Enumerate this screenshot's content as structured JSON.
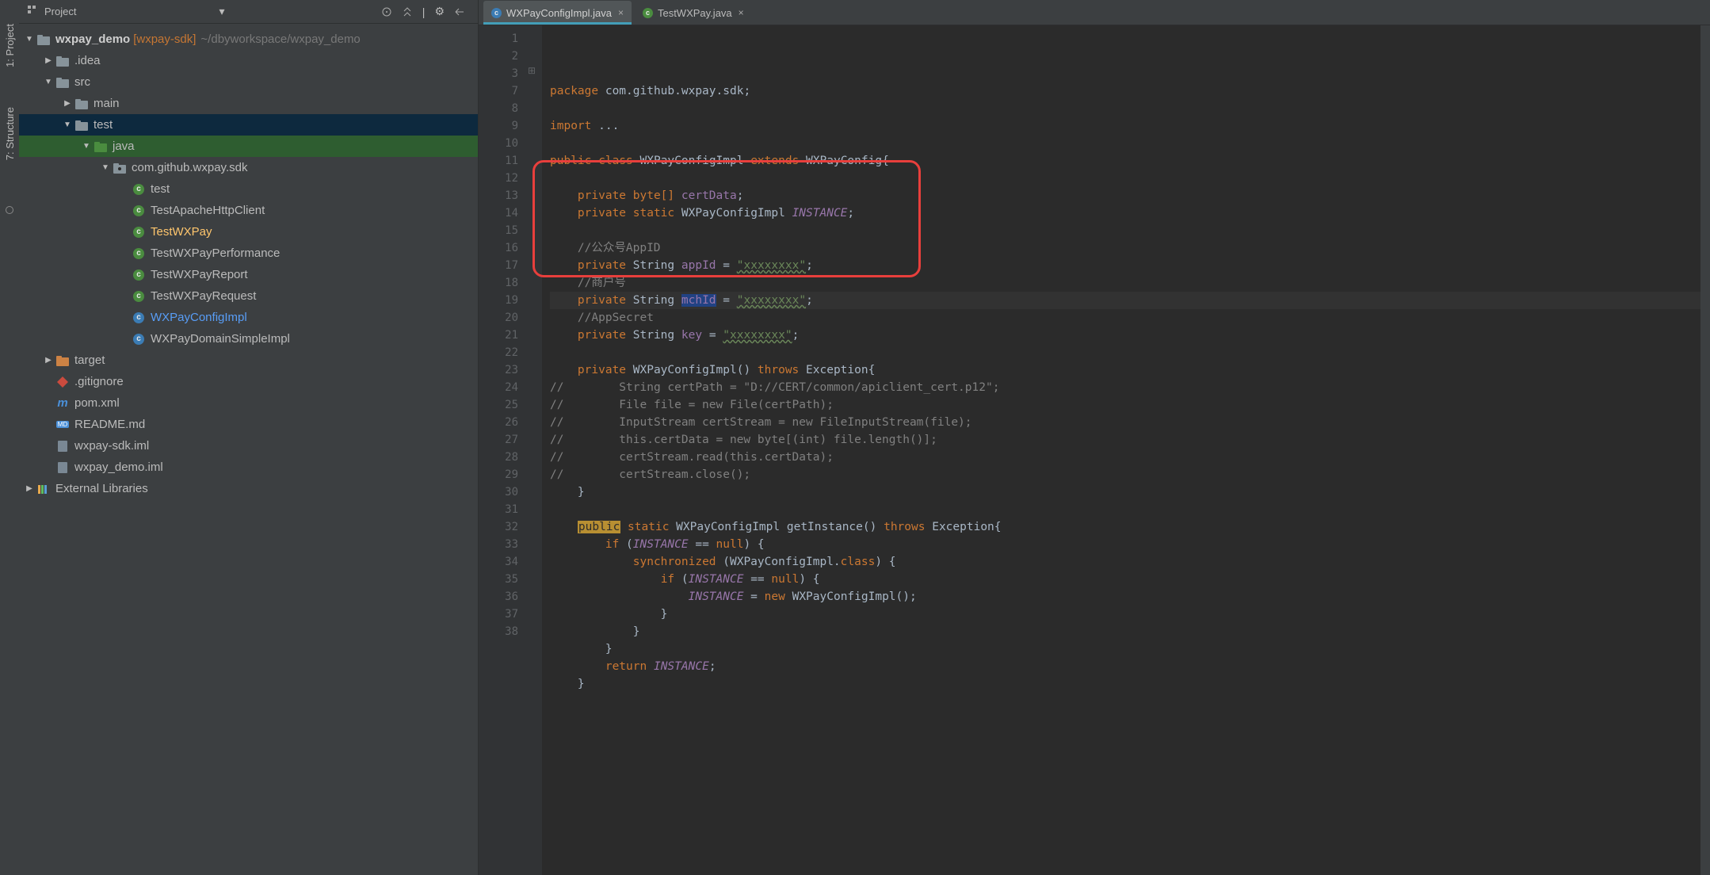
{
  "sideTools": {
    "project": "1: Project",
    "structure": "7: Structure"
  },
  "projectHeader": {
    "title": "Project"
  },
  "tree": {
    "root": {
      "name": "wxpay_demo",
      "module": "[wxpay-sdk]",
      "path": "~/dbyworkspace/wxpay_demo"
    },
    "idea": ".idea",
    "src": "src",
    "main": "main",
    "test": "test",
    "java": "java",
    "pkg": "com.github.wxpay.sdk",
    "files": [
      {
        "label": "test",
        "kind": "j"
      },
      {
        "label": "TestApacheHttpClient",
        "kind": "j"
      },
      {
        "label": "TestWXPay",
        "kind": "j",
        "sel": true
      },
      {
        "label": "TestWXPayPerformance",
        "kind": "j"
      },
      {
        "label": "TestWXPayReport",
        "kind": "j"
      },
      {
        "label": "TestWXPayRequest",
        "kind": "j"
      },
      {
        "label": "WXPayConfigImpl",
        "kind": "j",
        "blue": true
      },
      {
        "label": "WXPayDomainSimpleImpl",
        "kind": "j"
      }
    ],
    "target": "target",
    "others": [
      {
        "label": ".gitignore",
        "ico": "git"
      },
      {
        "label": "pom.xml",
        "ico": "m"
      },
      {
        "label": "README.md",
        "ico": "md"
      },
      {
        "label": "wxpay-sdk.iml",
        "ico": "f"
      },
      {
        "label": "wxpay_demo.iml",
        "ico": "f"
      }
    ],
    "ext": "External Libraries"
  },
  "tabs": [
    {
      "label": "WXPayConfigImpl.java",
      "active": true
    },
    {
      "label": "TestWXPay.java",
      "active": false
    }
  ],
  "code": {
    "lines": [
      1,
      2,
      3,
      7,
      8,
      9,
      10,
      11,
      12,
      13,
      14,
      15,
      16,
      17,
      18,
      19,
      20,
      21,
      22,
      23,
      24,
      25,
      26,
      27,
      28,
      29,
      30,
      31,
      32,
      33,
      34,
      35,
      36,
      37,
      38
    ],
    "l1": {
      "kw": "package",
      "pkg": "com.github.wxpay.sdk;"
    },
    "l3": {
      "kw": "import",
      "rest": "..."
    },
    "l8": {
      "p": "public",
      "c": "class",
      "name": "WXPayConfigImpl",
      "e": "extends",
      "sup": "WXPayConfig",
      "br": "{"
    },
    "l10": {
      "p": "private",
      "t": "byte[]",
      "n": "certData",
      "s": ";"
    },
    "l11": {
      "p": "private",
      "st": "static",
      "t": "WXPayConfigImpl",
      "n": "INSTANCE",
      "s": ";"
    },
    "l13": "//公众号AppID",
    "l14": {
      "p": "private",
      "t": "String",
      "n": "appId",
      "eq": " = ",
      "v": "\"xxxxxxxx\"",
      "s": ";"
    },
    "l15": "//商户号",
    "l16": {
      "p": "private",
      "t": "String",
      "n": "mchId",
      "eq": " = ",
      "v": "\"xxxxxxxx\"",
      "s": ";"
    },
    "l17": "//AppSecret",
    "l18": {
      "p": "private",
      "t": "String",
      "n": "key",
      "eq": " = ",
      "v": "\"xxxxxxxx\"",
      "s": ";"
    },
    "l20": {
      "p": "private",
      "name": "WXPayConfigImpl()",
      "th": "throws",
      "ex": "Exception{",
      "tail": ""
    },
    "l21": "//        String certPath = \"D://CERT/common/apiclient_cert.p12\";",
    "l22": "//        File file = new File(certPath);",
    "l23": "//        InputStream certStream = new FileInputStream(file);",
    "l24": "//        this.certData = new byte[(int) file.length()];",
    "l25": "//        certStream.read(this.certData);",
    "l26": "//        certStream.close();",
    "l27": "    }",
    "l29": {
      "p": "public",
      "st": "static",
      "t": "WXPayConfigImpl",
      "m": "getInstance()",
      "th": "throws",
      "ex": "Exception{"
    },
    "l30": {
      "kw": "if",
      "cond": "INSTANCE",
      "eq": " == ",
      "nul": "null",
      "rest": ") {"
    },
    "l31": {
      "kw": "synchronized",
      "rest": "(WXPayConfigImpl.",
      "cls": "class",
      "r2": ") {"
    },
    "l32": {
      "kw": "if",
      "cond": "INSTANCE",
      "eq": " == ",
      "nul": "null",
      "rest": ") {"
    },
    "l33": {
      "n": "INSTANCE",
      "eq": " = ",
      "kw": "new",
      "call": "WXPayConfigImpl();"
    },
    "l34": "            }",
    "l35": "        }",
    "l36": "    }",
    "l37": {
      "kw": "return",
      "n": "INSTANCE",
      "s": ";"
    },
    "l38": "}"
  }
}
